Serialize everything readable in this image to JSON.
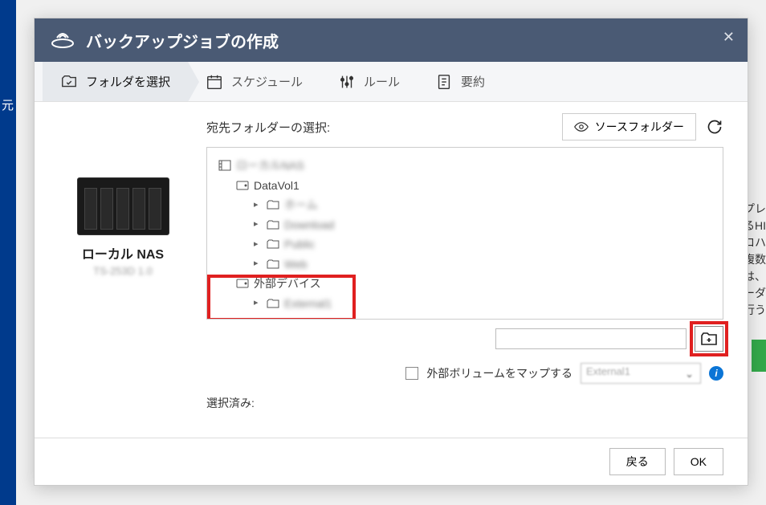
{
  "bg": {
    "sidebar": "元"
  },
  "header": {
    "title": "バックアップジョブの作成"
  },
  "steps": {
    "folders": "フォルダを選択",
    "schedule": "スケジュール",
    "rules": "ルール",
    "summary": "要約"
  },
  "left": {
    "nas_label": "ローカル NAS",
    "nas_sub": "TS-253D 1.0"
  },
  "panel": {
    "title": "宛先フォルダーの選択:",
    "source_button": "ソースフォルダー"
  },
  "tree": {
    "root": "ローカルNAS",
    "vol": "DataVol1",
    "f1": "ホーム",
    "f2": "Download",
    "f3": "Public",
    "f4": "Web",
    "ext": "外部デバイス",
    "extf": "External1"
  },
  "map": {
    "label": "外部ボリュームをマップする",
    "select": "External1"
  },
  "selected_label": "選択済み:",
  "footer": {
    "back": "戻る",
    "ok": "OK"
  }
}
